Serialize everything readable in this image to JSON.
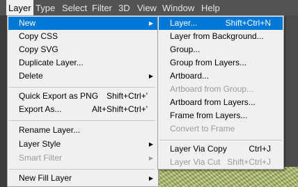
{
  "menubar": {
    "items": [
      "Layer",
      "Type",
      "Select",
      "Filter",
      "3D",
      "View",
      "Window",
      "Help"
    ]
  },
  "layer_menu": {
    "new": "New",
    "copy_css": "Copy CSS",
    "copy_svg": "Copy SVG",
    "duplicate_layer": "Duplicate Layer...",
    "delete": "Delete",
    "quick_export": "Quick Export as PNG",
    "quick_export_shortcut": "Shift+Ctrl+'",
    "export_as": "Export As...",
    "export_as_shortcut": "Alt+Shift+Ctrl+'",
    "rename_layer": "Rename Layer...",
    "layer_style": "Layer Style",
    "smart_filter": "Smart Filter",
    "new_fill_layer": "New Fill Layer"
  },
  "new_submenu": {
    "layer": "Layer...",
    "layer_shortcut": "Shift+Ctrl+N",
    "layer_from_background": "Layer from Background...",
    "group": "Group...",
    "group_from_layers": "Group from Layers...",
    "artboard": "Artboard...",
    "artboard_from_group": "Artboard from Group...",
    "artboard_from_layers": "Artboard from Layers...",
    "frame_from_layers": "Frame from Layers...",
    "convert_to_frame": "Convert to Frame",
    "layer_via_copy": "Layer Via Copy",
    "layer_via_copy_shortcut": "Ctrl+J",
    "layer_via_cut": "Layer Via Cut",
    "layer_via_cut_shortcut": "Shift+Ctrl+J"
  },
  "icons": {
    "submenu_arrow": "triangle-right-icon"
  },
  "colors": {
    "highlight": "#0078d7",
    "menu_bg": "#f0f0f0",
    "disabled_text": "#9a9a9a",
    "menubar_bg": "#535353"
  }
}
